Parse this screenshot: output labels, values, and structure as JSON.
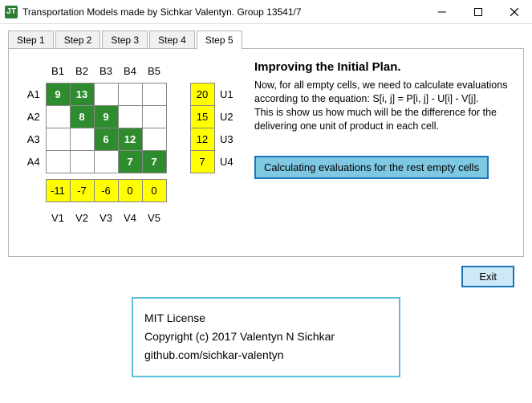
{
  "window": {
    "title": "Transportation Models made by Sichkar Valentyn. Group 13541/7",
    "app_icon_text": "JT"
  },
  "tabs": [
    "Step 1",
    "Step 2",
    "Step 3",
    "Step 4",
    "Step 5"
  ],
  "active_tab_index": 4,
  "grid": {
    "col_headers": [
      "B1",
      "B2",
      "B3",
      "B4",
      "B5"
    ],
    "row_headers": [
      "A1",
      "A2",
      "A3",
      "A4"
    ],
    "u_labels": [
      "U1",
      "U2",
      "U3",
      "U4"
    ],
    "v_labels": [
      "V1",
      "V2",
      "V3",
      "V4",
      "V5"
    ],
    "cells": [
      [
        {
          "v": "9",
          "c": "green"
        },
        {
          "v": "13",
          "c": "green"
        },
        {
          "v": "",
          "c": "cell"
        },
        {
          "v": "",
          "c": "cell"
        },
        {
          "v": "",
          "c": "cell"
        }
      ],
      [
        {
          "v": "",
          "c": "cell"
        },
        {
          "v": "8",
          "c": "green"
        },
        {
          "v": "9",
          "c": "green"
        },
        {
          "v": "",
          "c": "cell"
        },
        {
          "v": "",
          "c": "cell"
        }
      ],
      [
        {
          "v": "",
          "c": "cell"
        },
        {
          "v": "",
          "c": "cell"
        },
        {
          "v": "6",
          "c": "green"
        },
        {
          "v": "12",
          "c": "green"
        },
        {
          "v": "",
          "c": "cell"
        }
      ],
      [
        {
          "v": "",
          "c": "cell"
        },
        {
          "v": "",
          "c": "cell"
        },
        {
          "v": "",
          "c": "cell"
        },
        {
          "v": "7",
          "c": "green"
        },
        {
          "v": "7",
          "c": "green"
        }
      ]
    ],
    "u_values": [
      "20",
      "15",
      "12",
      "7"
    ],
    "v_values": [
      "-11",
      "-7",
      "-6",
      "0",
      "0"
    ]
  },
  "right": {
    "heading": "Improving the Initial Plan.",
    "desc": "Now, for all empty cells, we need to calculate evaluations according to the equation: S[i, j] = P[i, j] - U[i] - V[j].\nThis is show us how much will be the difference for the delivering one unit of product in each cell.",
    "calc_button": "Calculating evaluations for the rest empty cells"
  },
  "exit_button": "Exit",
  "license": {
    "line1": "MIT License",
    "line2": "Copyright (c) 2017 Valentyn N Sichkar",
    "line3": "github.com/sichkar-valentyn"
  }
}
